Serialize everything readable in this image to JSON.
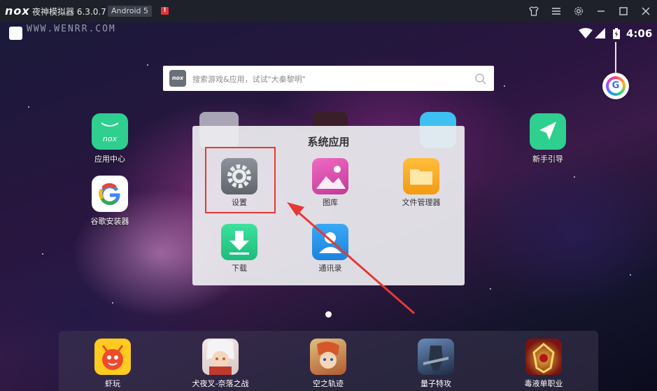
{
  "titlebar": {
    "logo": "nox",
    "title": "夜神模拟器 6.3.0.7",
    "android_badge": "Android 5",
    "alert": "!",
    "watermark": "WWW.WENRR.COM",
    "controls": [
      "shirt-icon",
      "menu-icon",
      "gear-icon",
      "minimize-icon",
      "maximize-icon",
      "close-icon"
    ]
  },
  "statusbar": {
    "time": "4:06"
  },
  "search": {
    "logo": "nox",
    "placeholder": "搜索游戏&应用，试试\"大秦黎明\""
  },
  "desktop": {
    "apps": [
      {
        "label": "应用中心",
        "icon": "nox-store-icon",
        "color": "#2ecf8f"
      },
      {
        "label": "谷歌安装器",
        "icon": "google-icon",
        "color": "#ffffff"
      },
      {
        "label": "新手引导",
        "icon": "guide-arrow-icon",
        "color": "#2ecf8f"
      }
    ]
  },
  "folder": {
    "title": "系统应用",
    "apps": [
      {
        "label": "设置",
        "icon": "settings-gear-icon",
        "color": "#7b7f88"
      },
      {
        "label": "图库",
        "icon": "gallery-icon",
        "color": "#e84fa7"
      },
      {
        "label": "文件管理器",
        "icon": "folder-icon",
        "color": "#f5a623"
      },
      {
        "label": "下载",
        "icon": "download-icon",
        "color": "#2ecf8f"
      },
      {
        "label": "通讯录",
        "icon": "contacts-icon",
        "color": "#2196f3"
      }
    ]
  },
  "dock": {
    "apps": [
      {
        "label": "虾玩",
        "icon": "xiawan-icon"
      },
      {
        "label": "犬夜叉-奈落之战",
        "icon": "inuyasha-icon"
      },
      {
        "label": "空之轨迹",
        "icon": "trails-icon"
      },
      {
        "label": "量子特攻",
        "icon": "quantum-icon"
      },
      {
        "label": "毒液单职业",
        "icon": "venom-icon"
      }
    ]
  }
}
